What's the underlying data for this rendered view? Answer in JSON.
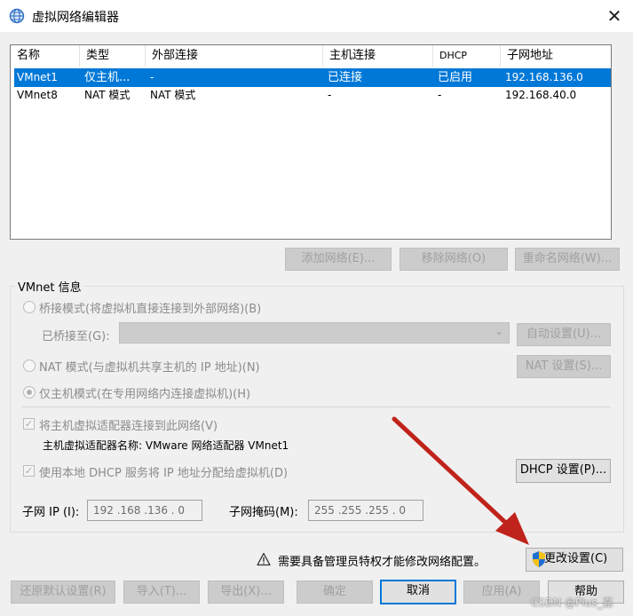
{
  "window": {
    "title": "虚拟网络编辑器",
    "close_icon": "close-icon"
  },
  "table": {
    "headers": [
      "名称",
      "类型",
      "外部连接",
      "主机连接",
      "DHCP",
      "子网地址"
    ],
    "rows": [
      {
        "name": "VMnet1",
        "type": "仅主机...",
        "external": "-",
        "host": "已连接",
        "dhcp": "已启用",
        "subnet": "192.168.136.0",
        "selected": true
      },
      {
        "name": "VMnet8",
        "type": "NAT 模式",
        "external": "NAT 模式",
        "host": "-",
        "dhcp": "-",
        "subnet": "192.168.40.0",
        "selected": false
      }
    ]
  },
  "list_buttons": {
    "add": "添加网络(E)...",
    "remove": "移除网络(O)",
    "rename": "重命名网络(W)..."
  },
  "vmnet_info": {
    "group_label": "VMnet 信息",
    "bridged_label": "桥接模式(将虚拟机直接连接到外部网络)(B)",
    "bridged_to_label": "已桥接至(G):",
    "bridged_to_value": "",
    "auto_button": "自动设置(U)...",
    "nat_label": "NAT 模式(与虚拟机共享主机的 IP 地址)(N)",
    "nat_button": "NAT 设置(S)...",
    "hostonly_label": "仅主机模式(在专用网络内连接虚拟机)(H)",
    "connect_adapter_label": "将主机虚拟适配器连接到此网络(V)",
    "adapter_name_label": "主机虚拟适配器名称: VMware 网络适配器 VMnet1",
    "dhcp_label": "使用本地 DHCP 服务将 IP 地址分配给虚拟机(D)",
    "dhcp_button": "DHCP 设置(P)...",
    "subnet_ip_label": "子网 IP (I):",
    "subnet_ip_value": "192 .168 .136 . 0",
    "subnet_mask_label": "子网掩码(M):",
    "subnet_mask_value": "255 .255 .255 . 0",
    "selected_mode": "hostonly"
  },
  "admin": {
    "warning": "需要具备管理员特权才能修改网络配置。",
    "change_button": "更改设置(C)"
  },
  "footer": {
    "restore": "还原默认设置(R)",
    "import": "导入(T)...",
    "export": "导出(X)...",
    "ok": "确定",
    "cancel": "取消",
    "apply": "应用(A)",
    "help": "帮助"
  },
  "watermark": "CSDN @Plus_嘉",
  "colors": {
    "selection": "#0078d7",
    "annotation_arrow": "#c0231b"
  }
}
